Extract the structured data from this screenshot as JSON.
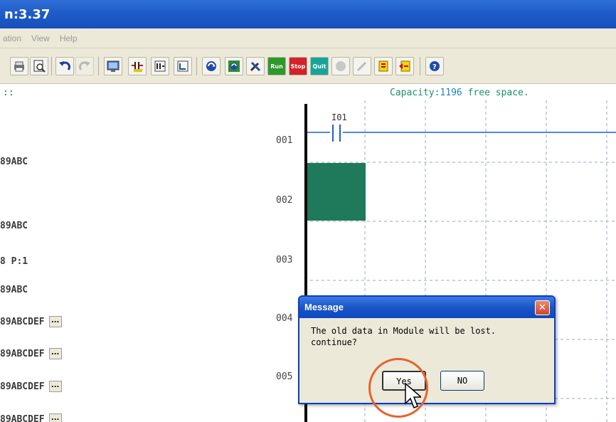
{
  "window": {
    "title_fragment": "n:3.37"
  },
  "menu": {
    "items": [
      "ation",
      "View",
      "Help"
    ]
  },
  "toolbar": {
    "run_label": "Run",
    "stop_label": "Stop",
    "quit_label": "Quit"
  },
  "status": {
    "left_fragment": "::",
    "capacity_prefix": "Capacity:",
    "capacity_value": "1196",
    "capacity_suffix": " free space."
  },
  "left_panel": {
    "rows": [
      {
        "text": "89ABC",
        "has_button": false
      },
      {
        "text": "89ABC",
        "has_button": false
      },
      {
        "text": "8 P:1",
        "has_button": false
      },
      {
        "text": "89ABC",
        "has_button": false
      },
      {
        "text": "89ABCDEF",
        "has_button": true
      },
      {
        "text": "89ABCDEF",
        "has_button": true
      },
      {
        "text": "89ABCDEF",
        "has_button": true
      },
      {
        "text": "89ABCDEF",
        "has_button": true
      }
    ],
    "button_label": "..."
  },
  "ladder": {
    "row_numbers": [
      "001",
      "002",
      "003",
      "004",
      "005"
    ],
    "contact_label": "I01",
    "selection_color": "#1e7a5a",
    "wire_color": "#1f5fd1"
  },
  "dialog": {
    "title": "Message",
    "message_line1": "The old data in Module will be lost.",
    "message_line2": "continue?",
    "yes_label": "Yes",
    "no_label": "NO",
    "close_label": "✕"
  }
}
